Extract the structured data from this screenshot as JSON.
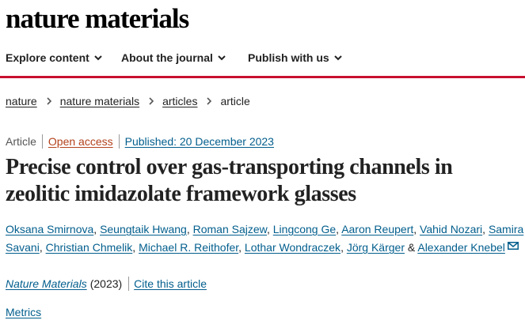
{
  "site": {
    "logo": "nature materials"
  },
  "nav": {
    "items": [
      {
        "label": "Explore content",
        "icon": "chevron-down-icon"
      },
      {
        "label": "About the journal",
        "icon": "chevron-down-icon"
      },
      {
        "label": "Publish with us",
        "icon": "chevron-down-icon"
      }
    ]
  },
  "colors": {
    "accent": "#c8102e",
    "link": "#025e8d",
    "open_access": "#b3411b"
  },
  "breadcrumb": {
    "items": [
      "nature",
      "nature materials",
      "articles"
    ],
    "current": "article"
  },
  "article": {
    "type": "Article",
    "open_access": "Open access",
    "published": "Published: 20 December 2023",
    "title": "Precise control over gas-transporting channels in zeolitic imidazolate framework glasses",
    "authors": [
      "Oksana Smirnova",
      "Seungtaik Hwang",
      "Roman Sajzew",
      "Lingcong Ge",
      "Aaron Reupert",
      "Vahid Nozari",
      "Samira Savani",
      "Christian Chmelik",
      "Michael R. Reithofer",
      "Lothar Wondraczek",
      "Jörg Kärger",
      "Alexander Knebel"
    ],
    "author_separator": ", ",
    "author_last_joiner": " & ",
    "journal": "Nature Materials",
    "year": "(2023)",
    "cite": "Cite this article",
    "metrics": "Metrics"
  }
}
